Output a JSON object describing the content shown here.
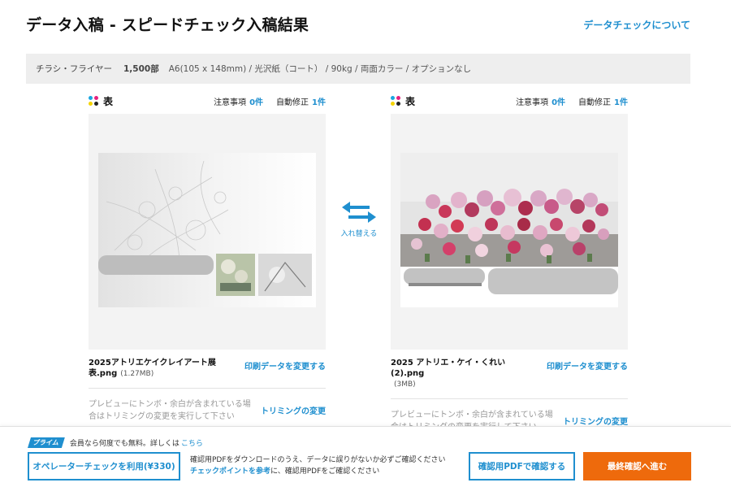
{
  "header": {
    "title": "データ入稿 - スピードチェック入稿結果",
    "about_link": "データチェックについて"
  },
  "spec": {
    "product": "チラシ・フライヤー",
    "quantity": "1,500部",
    "detail": "A6(105 x 148mm) / 光沢紙（コート） / 90kg / 両面カラー / オプションなし"
  },
  "sides": [
    {
      "label": "表",
      "notice_label": "注意事項",
      "notice_count": "0件",
      "autofix_label": "自動修正",
      "autofix_count": "1件",
      "file_name": "2025アトリエケイクレイアート展表.png",
      "file_size": "(1.27MB)",
      "change_link": "印刷データを変更する",
      "trim_note": "プレビューにトンボ・余白が含まれている場合はトリミングの変更を実行して下さい",
      "trim_link": "トリミングの変更"
    },
    {
      "label": "表",
      "notice_label": "注意事項",
      "notice_count": "0件",
      "autofix_label": "自動修正",
      "autofix_count": "1件",
      "file_name": "2025 アトリエ・ケイ・くれい (2).png",
      "file_size": "(3MB)",
      "change_link": "印刷データを変更する",
      "trim_note": "プレビューにトンボ・余白が含まれている場合はトリミングの変更を実行して下さい",
      "trim_link": "トリミングの変更"
    }
  ],
  "swap": {
    "label": "入れ替える",
    "icon": "swap-arrows-icon"
  },
  "footer": {
    "prime_badge": "プライム",
    "prime_text": "会員なら何度でも無料。詳しくは",
    "prime_link": "こちら",
    "operator_button": "オペレーターチェックを利用(¥330)",
    "note_line1": "確認用PDFをダウンロードのうえ、データに誤りがないか必ずご確認ください",
    "note_link": "チェックポイントを参考",
    "note_line2_rest": "に、確認用PDFをご確認ください",
    "pdf_button": "確認用PDFで確認する",
    "final_button": "最終確認へ進む"
  },
  "colors": {
    "accent": "#1f8fcf",
    "primary_action": "#ee6a0c",
    "spec_bar_bg": "#eeeeee",
    "preview_bg": "#f3f3f3"
  }
}
